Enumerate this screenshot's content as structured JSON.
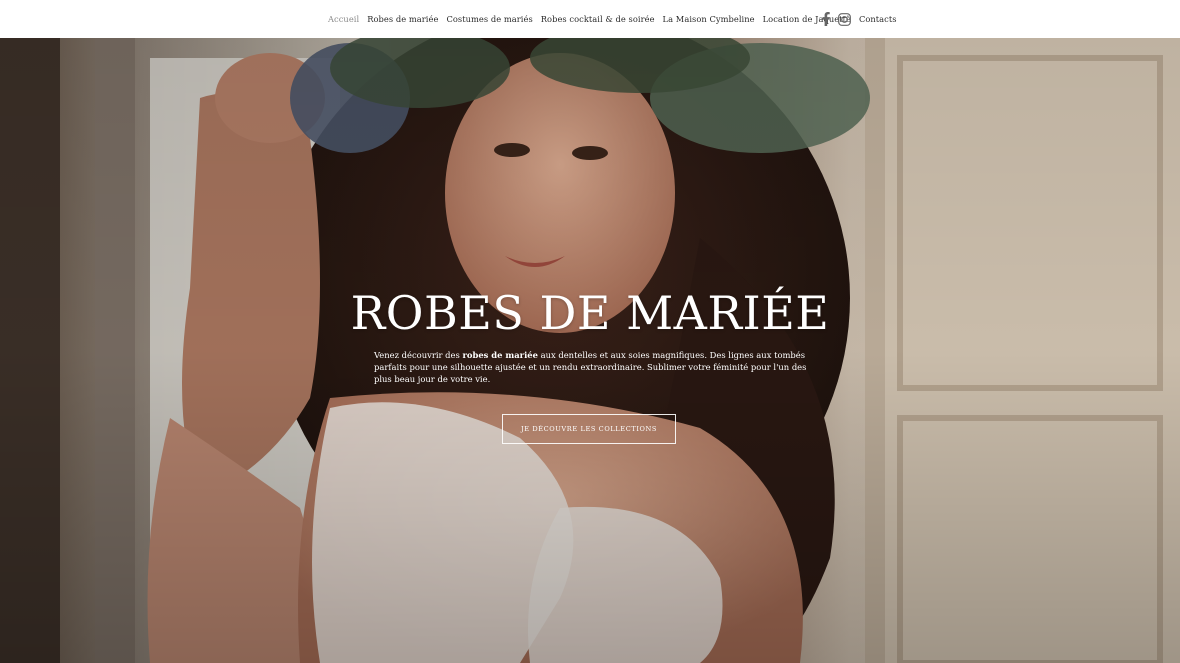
{
  "nav": {
    "items": [
      {
        "label": "Accueil",
        "active": true
      },
      {
        "label": "Robes de mariée",
        "active": false
      },
      {
        "label": "Costumes de mariés",
        "active": false
      },
      {
        "label": "Robes cocktail & de soirée",
        "active": false
      },
      {
        "label": "La Maison Cymbeline",
        "active": false
      },
      {
        "label": "Location de Jaquette",
        "active": false
      },
      {
        "label": "Contacts",
        "active": false
      }
    ],
    "social": [
      {
        "icon": "facebook-icon"
      },
      {
        "icon": "instagram-icon"
      }
    ]
  },
  "hero": {
    "title": "ROBES DE MARIÉE",
    "description_prefix": "Venez découvrir des ",
    "description_bold": "robes de mariée",
    "description_suffix": " aux dentelles et aux soies magnifiques. Des lignes aux tombés parfaits pour une silhouette ajustée et un rendu extraordinaire. Sublimer votre féminité pour l'un des plus beau jour de votre vie.",
    "cta_label": "JE DÉCOUVRE LES COLLECTIONS"
  },
  "colors": {
    "nav_text": "#2b2b2b",
    "nav_active": "#8a8a8a",
    "hero_text": "#ffffff"
  }
}
